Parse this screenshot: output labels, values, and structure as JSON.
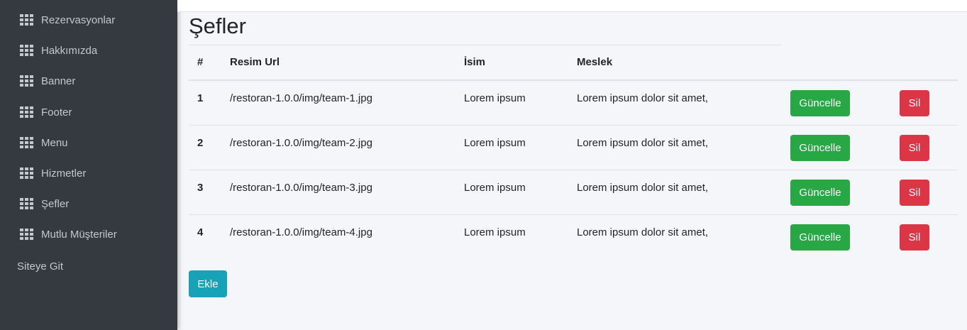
{
  "sidebar": {
    "items": [
      {
        "label": "Rezervasyonlar",
        "icon": "grid-icon"
      },
      {
        "label": "Hakkımızda",
        "icon": "grid-icon"
      },
      {
        "label": "Banner",
        "icon": "grid-icon"
      },
      {
        "label": "Footer",
        "icon": "grid-icon"
      },
      {
        "label": "Menu",
        "icon": "grid-icon"
      },
      {
        "label": "Hizmetler",
        "icon": "grid-icon"
      },
      {
        "label": "Şefler",
        "icon": "grid-icon"
      },
      {
        "label": "Mutlu Müşteriler",
        "icon": "grid-icon"
      }
    ],
    "site_link": "Siteye Git"
  },
  "main": {
    "title": "Şefler",
    "table": {
      "headers": [
        "#",
        "Resim Url",
        "İsim",
        "Meslek"
      ],
      "rows": [
        {
          "num": "1",
          "url": "/restoran-1.0.0/img/team-1.jpg",
          "name": "Lorem ipsum",
          "job": "Lorem ipsum dolor sit amet,"
        },
        {
          "num": "2",
          "url": "/restoran-1.0.0/img/team-2.jpg",
          "name": "Lorem ipsum",
          "job": "Lorem ipsum dolor sit amet,"
        },
        {
          "num": "3",
          "url": "/restoran-1.0.0/img/team-3.jpg",
          "name": "Lorem ipsum",
          "job": "Lorem ipsum dolor sit amet,"
        },
        {
          "num": "4",
          "url": "/restoran-1.0.0/img/team-4.jpg",
          "name": "Lorem ipsum",
          "job": "Lorem ipsum dolor sit amet,"
        }
      ],
      "update_label": "Güncelle",
      "delete_label": "Sil"
    },
    "add_label": "Ekle"
  },
  "colors": {
    "sidebar_bg": "#343a40",
    "update": "#28a745",
    "delete": "#dc3545",
    "add": "#17a2b8"
  }
}
